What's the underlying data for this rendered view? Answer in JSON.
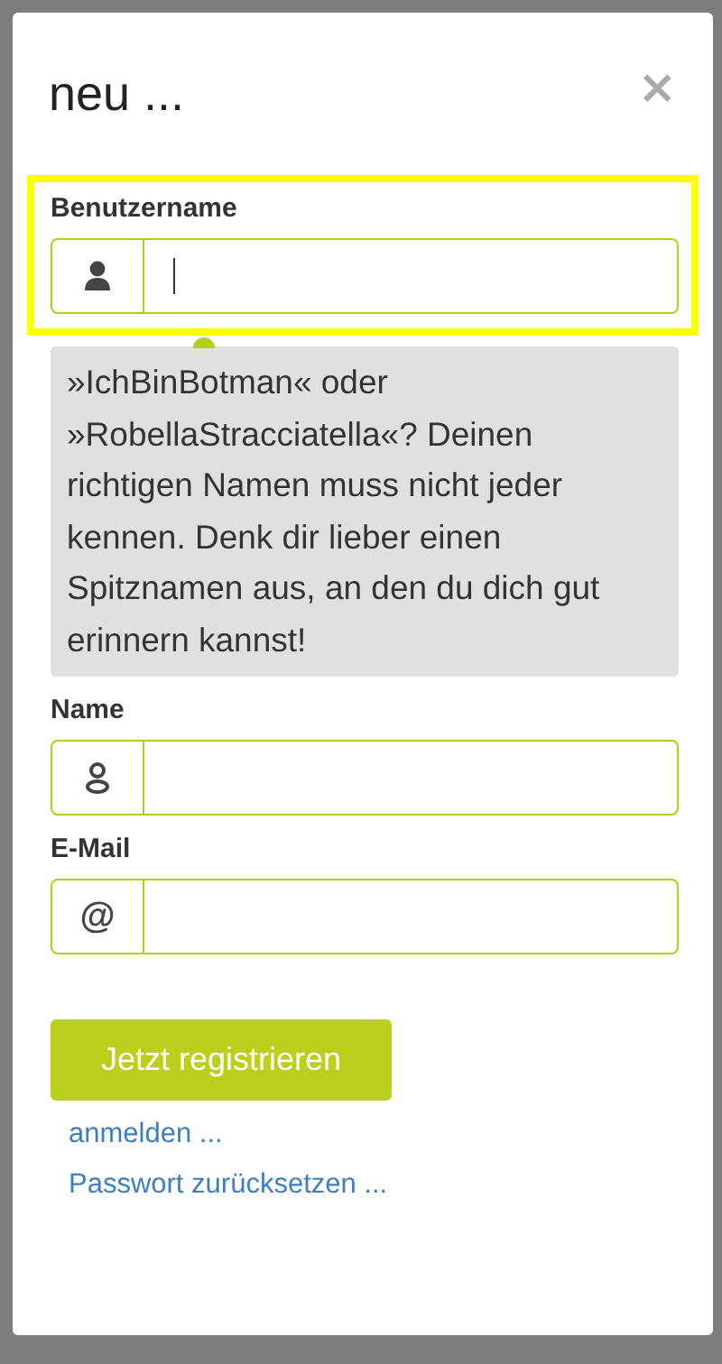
{
  "dialog": {
    "title": "neu ...",
    "close": "×"
  },
  "fields": [
    {
      "label": "Benutzername",
      "kind": "person-filled",
      "highlighted": true,
      "focused": true,
      "tooltip": "»IchBinBotman« oder »RobellaStracciatella«? Deinen richtigen Namen muss nicht jeder kennen. Denk dir lieber einen Spitznamen aus, an den du dich gut erinnern kannst!"
    },
    {
      "label": "Name",
      "kind": "person-outline",
      "highlighted": false,
      "focused": false
    },
    {
      "label": "E-Mail",
      "kind": "symbol",
      "symbol": "@",
      "highlighted": false,
      "focused": false
    }
  ],
  "submit": "Jetzt registrieren",
  "links": [
    "anmelden ...",
    "Passwort zurücksetzen ..."
  ]
}
